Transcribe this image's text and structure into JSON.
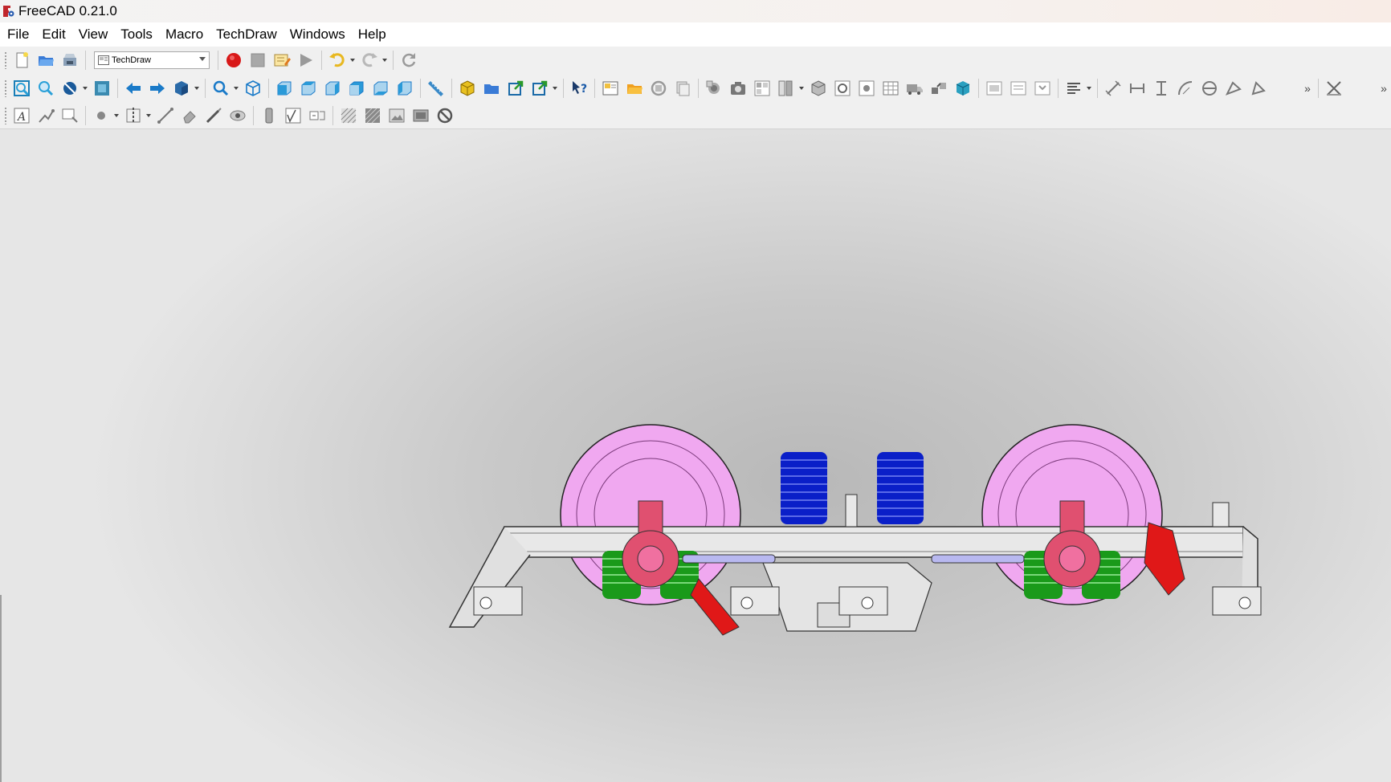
{
  "window": {
    "title": "FreeCAD 0.21.0"
  },
  "menubar": {
    "items": [
      {
        "label": "File"
      },
      {
        "label": "Edit"
      },
      {
        "label": "View"
      },
      {
        "label": "Tools"
      },
      {
        "label": "Macro"
      },
      {
        "label": "TechDraw"
      },
      {
        "label": "Windows"
      },
      {
        "label": "Help"
      }
    ]
  },
  "toolbar": {
    "workbench_selector": {
      "value": "TechDraw"
    },
    "row1_icons": [
      "new-document-icon",
      "open-folder-icon",
      "save-icon",
      "record-macro-icon",
      "stop-macro-icon",
      "edit-macro-icon",
      "run-macro-icon",
      "undo-icon",
      "redo-icon",
      "refresh-icon"
    ],
    "row2_icons": [
      "fit-all-icon",
      "fit-selection-icon",
      "draw-style-icon",
      "bounding-box-icon",
      "back-arrow-icon",
      "forward-arrow-icon",
      "view-menu-icon",
      "zoom-icon",
      "isometric-view-icon",
      "front-view-icon",
      "top-view-icon",
      "right-view-icon",
      "rear-view-icon",
      "bottom-view-icon",
      "left-view-icon",
      "measure-icon",
      "part-icon",
      "group-icon",
      "link-icon",
      "link-actions-icon",
      "whats-this-icon"
    ],
    "row3_icons": [
      "annotation-icon",
      "leader-icon",
      "rich-annotation-icon",
      "vertex-icon",
      "centerline-icon",
      "cosmetic-line-icon",
      "cosmetic-eraser-icon",
      "decorate-line-icon",
      "show-all-icon",
      "weld-symbol-icon",
      "surface-finish-icon",
      "tolerance-icon",
      "hatch-icon",
      "geometric-hatch-icon",
      "image-icon",
      "toggle-frames-icon",
      "no-sign-icon"
    ]
  },
  "colors": {
    "spring_blue": "#0a1fc8",
    "wheel_pink": "#f0a8f0",
    "spring_green": "#1a9a1a",
    "axlebox_red": "#e05070",
    "brake_red": "#e01818",
    "link_lavender": "#b8b8f0",
    "frame_gray": "#e8e8e8",
    "record_red": "#e01010",
    "accent_blue": "#2a7bd6",
    "teal": "#1a9ab0"
  }
}
